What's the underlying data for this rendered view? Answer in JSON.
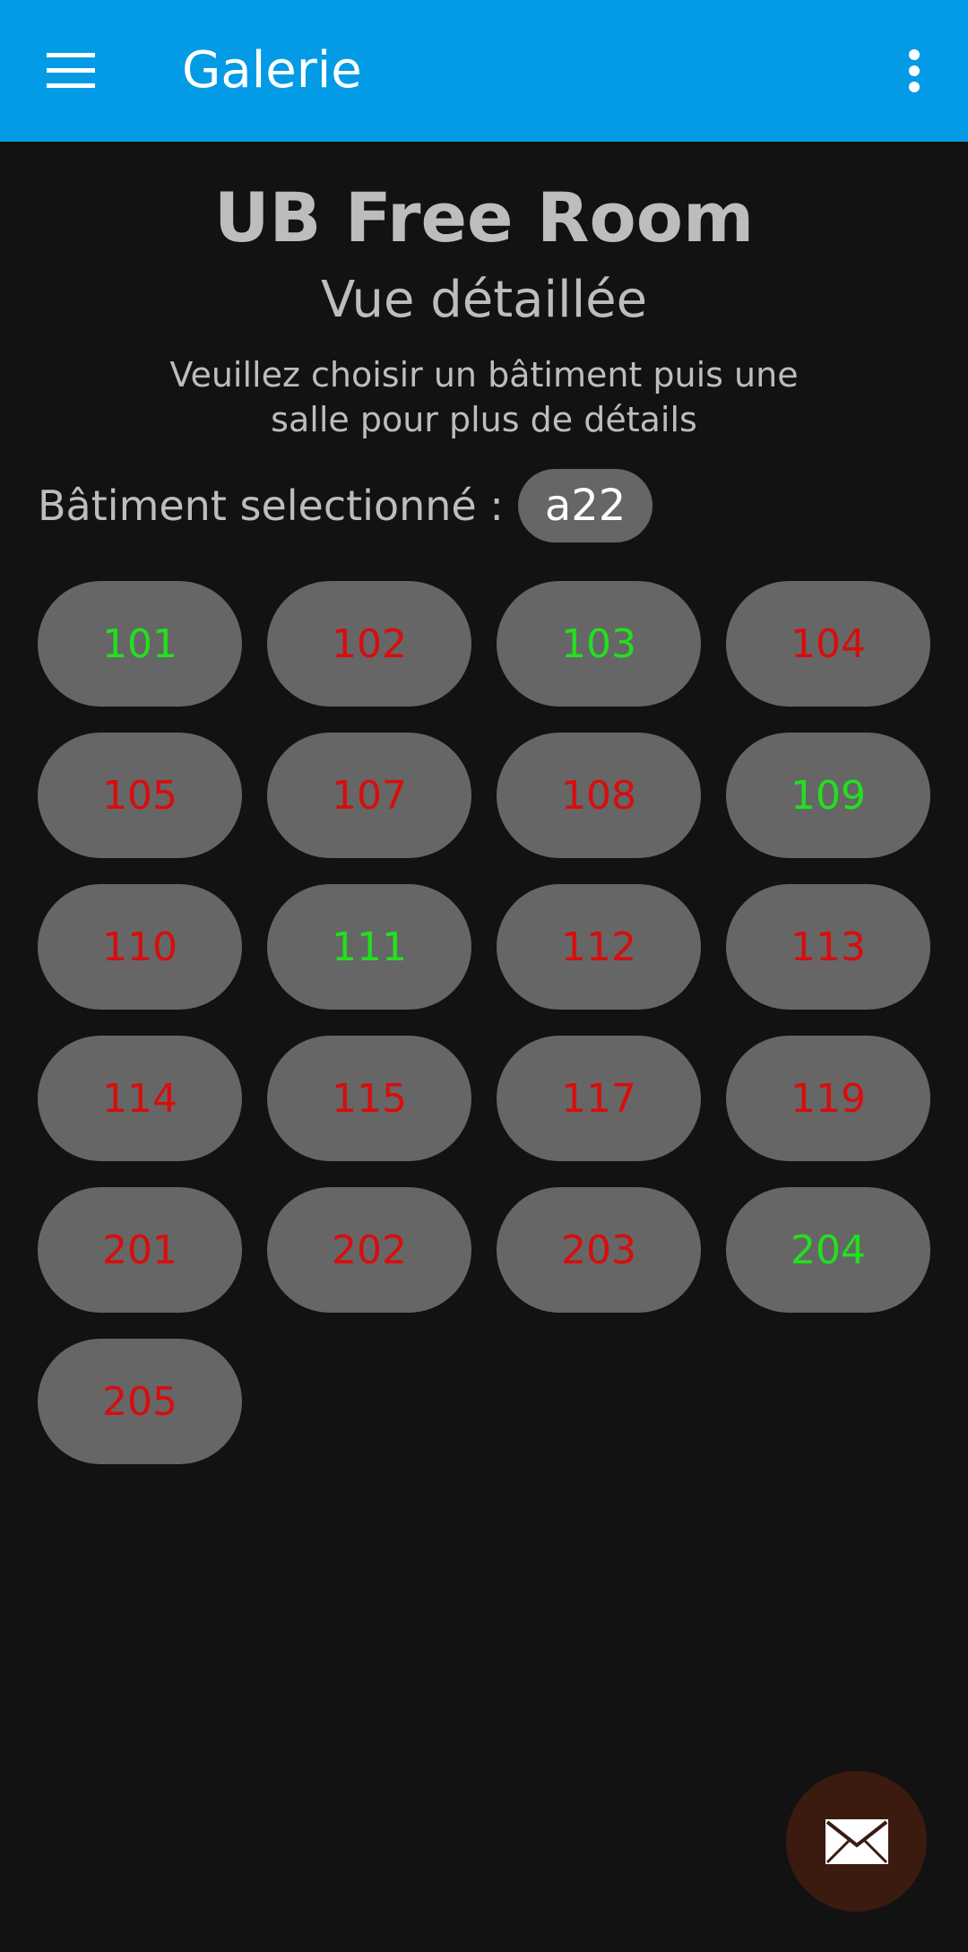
{
  "appbar": {
    "title": "Galerie",
    "menu_icon": "menu-icon",
    "more_icon": "more-vert-icon",
    "background": "#039BE5"
  },
  "header": {
    "title": "UB Free Room",
    "subtitle": "Vue détaillée",
    "instructions": "Veuillez choisir un bâtiment puis une salle pour plus de détails"
  },
  "building": {
    "label": "Bâtiment selectionné :",
    "selected": "a22"
  },
  "colors": {
    "free": "#22e01e",
    "occupied": "#d80d0d",
    "chip": "#666666",
    "background": "#121212"
  },
  "rooms": [
    {
      "number": "101",
      "status": "free"
    },
    {
      "number": "102",
      "status": "occupied"
    },
    {
      "number": "103",
      "status": "free"
    },
    {
      "number": "104",
      "status": "occupied"
    },
    {
      "number": "105",
      "status": "occupied"
    },
    {
      "number": "107",
      "status": "occupied"
    },
    {
      "number": "108",
      "status": "occupied"
    },
    {
      "number": "109",
      "status": "free"
    },
    {
      "number": "110",
      "status": "occupied"
    },
    {
      "number": "111",
      "status": "free"
    },
    {
      "number": "112",
      "status": "occupied"
    },
    {
      "number": "113",
      "status": "occupied"
    },
    {
      "number": "114",
      "status": "occupied"
    },
    {
      "number": "115",
      "status": "occupied"
    },
    {
      "number": "117",
      "status": "occupied"
    },
    {
      "number": "119",
      "status": "occupied"
    },
    {
      "number": "201",
      "status": "occupied"
    },
    {
      "number": "202",
      "status": "occupied"
    },
    {
      "number": "203",
      "status": "occupied"
    },
    {
      "number": "204",
      "status": "free"
    },
    {
      "number": "205",
      "status": "occupied"
    }
  ],
  "fab": {
    "icon": "mail-icon",
    "color": "#3b1a10"
  }
}
